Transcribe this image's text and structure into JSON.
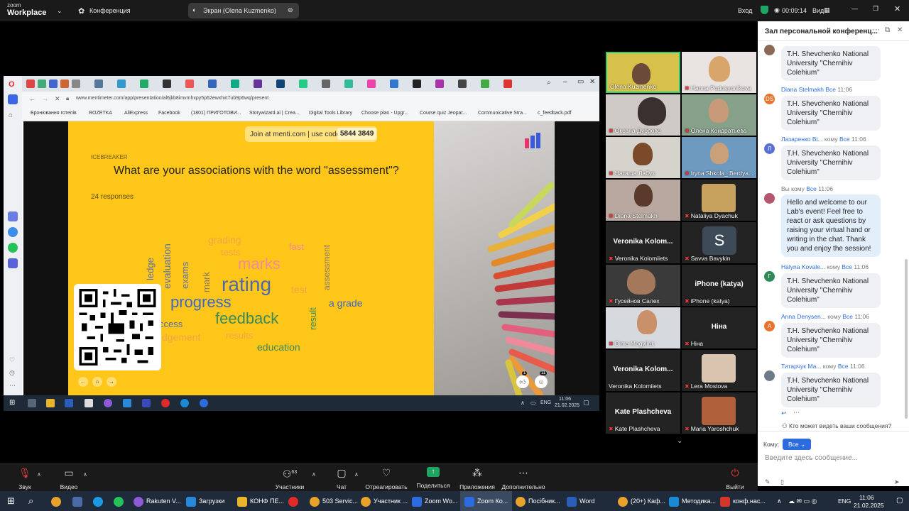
{
  "zoom": {
    "logo_line1": "zoom",
    "logo_line2": "Workplace",
    "meeting_label": "Конференция",
    "share_label": "Экран (Olena Kuzmenko)",
    "login_label": "Вход",
    "timer": "00:09:14",
    "view_label": "Вид"
  },
  "browser": {
    "url": "www.mentimeter.com/app/presentation/al6jkb8imvmhxpy5p62ewxhxt7ub9p6wq/present",
    "bookmarks": [
      "Бронювання готелів",
      "ROZETKA",
      "AliExpress",
      "Facebook",
      "(1801) ПРИГОТОВИ...",
      "Storywizard.ai | Crea...",
      "Digital Tools Library",
      "Choose plan - Upgr...",
      "Course quiz Jeopar...",
      "Communicative Stra...",
      "c_feedback.pdf"
    ]
  },
  "slide": {
    "join_text": "Join at menti.com | use code",
    "join_code": "5844 3849",
    "kicker": "ICEBREAKER",
    "question": "What are your associations with the word \"assessment\"?",
    "responses": "24 responses",
    "words": {
      "grading": "grading",
      "tests": "tests",
      "fast": "fast",
      "marks": "marks",
      "evaluation": "evaluation",
      "exams": "exams",
      "mark": "mark",
      "ledge": "ledge",
      "assessment": "assessment",
      "rating": "rating",
      "test": "test",
      "progress": "progress",
      "a_grade": "a grade",
      "result": "result",
      "feedback": "feedback",
      "ccess": "ccess",
      "results": "results",
      "dgement": "dgement",
      "education": "education"
    },
    "reaction_count_1": "1",
    "reaction_count_2": "11"
  },
  "inner_taskbar": {
    "lang": "ENG",
    "time": "11:06",
    "date": "21.02.2025"
  },
  "gallery": [
    {
      "name": "Olena Kuzmenko",
      "big": ""
    },
    {
      "name": "Hanna Podosynnikova",
      "big": ""
    },
    {
      "name": "Оксана Дуброва",
      "big": ""
    },
    {
      "name": "Олена Кондратьева",
      "big": ""
    },
    {
      "name": "Наташа Лабуз",
      "big": ""
    },
    {
      "name": "Iryna Shkola_ Berdya...",
      "big": ""
    },
    {
      "name": "Diana Stelmakh",
      "big": ""
    },
    {
      "name": "Nataliya Dyachuk",
      "big": ""
    },
    {
      "name": "Veronika Kolomiiets",
      "big": "Veronika  Kolom..."
    },
    {
      "name": "Savva Bavykin",
      "big": "S"
    },
    {
      "name": "Гусейнов Салех",
      "big": ""
    },
    {
      "name": "iPhone (katya)",
      "big": "iPhone (katya)"
    },
    {
      "name": "Dima Mogyliuk",
      "big": ""
    },
    {
      "name": "Ніна",
      "big": "Ніна"
    },
    {
      "name": "Veronika Kolomiiets",
      "big": "Veronika  Kolom..."
    },
    {
      "name": "Lera Mostova",
      "big": ""
    },
    {
      "name": "Kate Plashcheva",
      "big": "Kate Plashcheva"
    },
    {
      "name": "Maria Yaroshchuk",
      "big": ""
    }
  ],
  "chat": {
    "title": "Зал персональной конференц...",
    "messages": [
      {
        "sender": "",
        "to_label": "",
        "to": "",
        "time": "",
        "text": "T.H. Shevchenko National University \"Chernihiv Colehium\"",
        "avatar": "",
        "color": "#8a6a55"
      },
      {
        "sender": "Diana Stelmakh",
        "to_label": "",
        "to": "Все",
        "time": "11:06",
        "text": "T.H. Shevchenko National University \"Chernihiv Colehium\"",
        "avatar": "DS",
        "color": "#e8742c"
      },
      {
        "sender": "Лазаренко Ві...",
        "to_label": "кому",
        "to": "Все",
        "time": "11:06",
        "text": "T.H. Shevchenko National University \"Chernihiv Colehium\"",
        "avatar": "Л",
        "color": "#5a6fd6"
      },
      {
        "sender": "Вы",
        "to_label": "кому",
        "to": "Все",
        "time": "11:06",
        "text": "Hello and welcome to our Lab's event! Feel free to react or ask questions by raising your virtual hand or writing in the chat. Thank you and enjoy the session!",
        "avatar": "",
        "color": "#b5566e"
      },
      {
        "sender": "Halyna Kovale...",
        "to_label": "кому",
        "to": "Все",
        "time": "11:06",
        "text": "T.H. Shevchenko National University \"Chernihiv Colehium\"",
        "avatar": "Г",
        "color": "#2e8b57"
      },
      {
        "sender": "Anna Denysen...",
        "to_label": "кому",
        "to": "Все",
        "time": "11:06",
        "text": "T.H. Shevchenko National University \"Chernihiv Colehium\"",
        "avatar": "A",
        "color": "#e8742c"
      },
      {
        "sender": "Титарчук Ма...",
        "to_label": "кому",
        "to": "Все",
        "time": "11:06",
        "text": "T.H. Shevchenko National University \"Chernihiv Colehium\"",
        "avatar": "",
        "color": "#6d7a88"
      }
    ],
    "visibility_note": "Кто может видеть ваши сообщения?",
    "to_label": "Кому:",
    "to_value": "Все",
    "input_placeholder": "Введите здесь сообщение..."
  },
  "toolbar": {
    "audio": "Звук",
    "video": "Видео",
    "participants": "Участники",
    "participants_count": "63",
    "chat": "Чат",
    "react": "Отреагировать",
    "share": "Поделиться",
    "apps": "Приложения",
    "more": "Дополнительно",
    "leave": "Выйти"
  },
  "taskbar": {
    "items": [
      "Rakuten V...",
      "Загрузки",
      "КОНФ ПЕ...",
      "",
      "503 Servic...",
      "Участник ...",
      "Zoom Wo...",
      "Zoom Ко...",
      "Посібник...",
      "Word",
      "(20+) Каф...",
      "Методика...",
      "конф.нас..."
    ],
    "lang": "ENG",
    "time": "11:06",
    "date": "21.02.2025"
  },
  "colors": {
    "menti_yellow": "#ffc61a",
    "zoom_share_green": "#1fa463",
    "chat_accent": "#2d6cdf"
  }
}
